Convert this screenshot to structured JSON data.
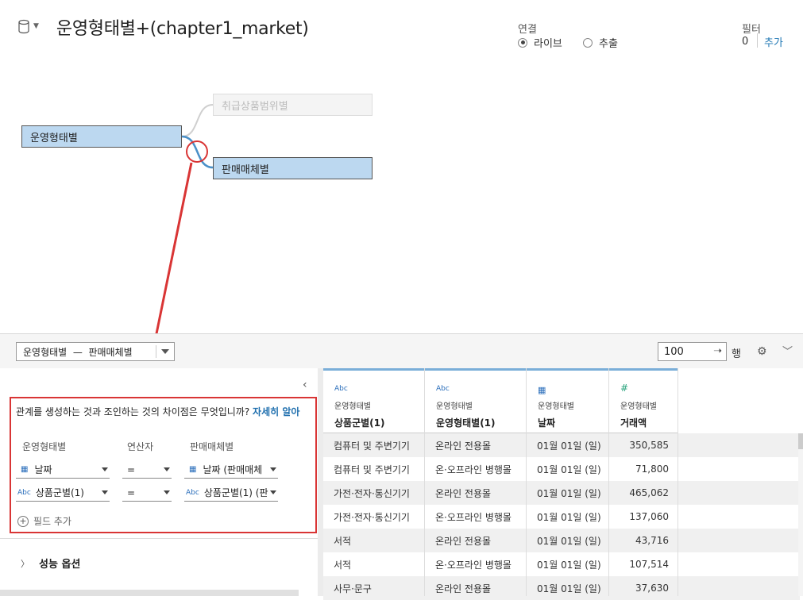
{
  "header": {
    "title": "운영형태별+(chapter1_market)",
    "connection": {
      "label": "연결",
      "options": [
        {
          "label": "라이브",
          "selected": true
        },
        {
          "label": "추출",
          "selected": false
        }
      ]
    },
    "filters": {
      "label": "필터",
      "count": "0",
      "add_label": "추가"
    }
  },
  "canvas": {
    "main_table": "운영형태별",
    "ghost_table": "취급상품범위별",
    "selected_table": "판매매체별",
    "annotation_color": "#d93535"
  },
  "toolbar": {
    "relationship_select": "운영형태별  —  판매매체별",
    "rows_value": "100",
    "rows_label": "행"
  },
  "join_panel": {
    "question": "관계를 생성하는 것과 조인하는 것의 차이점은 무엇입니까?",
    "learn_more": "자세히 알아",
    "columns": {
      "left": "운영형태별",
      "operator": "연산자",
      "right": "판매매체별"
    },
    "rows": [
      {
        "left_type": "calendar",
        "left": "날짜",
        "operator": "=",
        "right_type": "calendar",
        "right": "날짜 (판매매체"
      },
      {
        "left_type": "Abc",
        "left": "상품군별(1)",
        "operator": "=",
        "right_type": "Abc",
        "right": "상품군별(1) (판"
      }
    ],
    "add_field": "필드 추가",
    "performance_options": "성능 옵션"
  },
  "grid": {
    "columns": [
      {
        "type": "Abc",
        "source": "운영형태별",
        "name": "상품군별(1)"
      },
      {
        "type": "Abc",
        "source": "운영형태별",
        "name": "운영형태별(1)"
      },
      {
        "type": "calendar",
        "source": "운영형태별",
        "name": "날짜"
      },
      {
        "type": "#",
        "source": "운영형태별",
        "name": "거래액"
      }
    ],
    "rows": [
      [
        "컴퓨터 및 주변기기",
        "온라인 전용몰",
        "01월 01일 (일)",
        "350,585"
      ],
      [
        "컴퓨터 및 주변기기",
        "온·오프라인 병행몰",
        "01월 01일 (일)",
        "71,800"
      ],
      [
        "가전·전자·통신기기",
        "온라인 전용몰",
        "01월 01일 (일)",
        "465,062"
      ],
      [
        "가전·전자·통신기기",
        "온·오프라인 병행몰",
        "01월 01일 (일)",
        "137,060"
      ],
      [
        "서적",
        "온라인 전용몰",
        "01월 01일 (일)",
        "43,716"
      ],
      [
        "서적",
        "온·오프라인 병행몰",
        "01월 01일 (일)",
        "107,514"
      ],
      [
        "사무·문구",
        "온라인 전용몰",
        "01월 01일 (일)",
        "37,630"
      ]
    ]
  }
}
